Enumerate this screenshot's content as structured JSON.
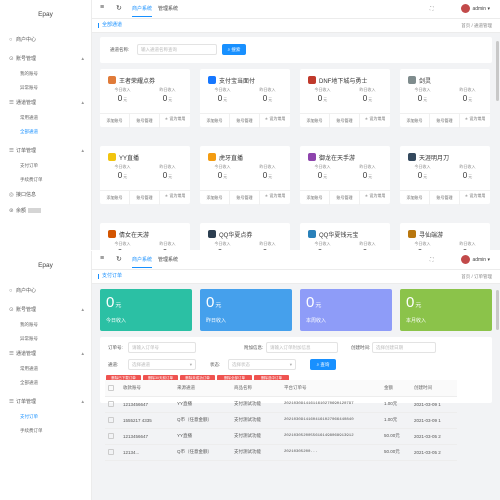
{
  "app_name": "Epay",
  "sidebar": {
    "items": [
      {
        "label": "商户中心"
      },
      {
        "label": "账号管理",
        "sub": [
          "我的账号",
          "异常账号"
        ]
      },
      {
        "label": "通道管理",
        "sub": [
          "常用通道",
          "全部通道"
        ]
      },
      {
        "label": "订单管理",
        "sub": [
          "支付订单",
          "手续费订单"
        ]
      },
      {
        "label": "接口信息"
      },
      {
        "label": "余额"
      }
    ]
  },
  "topbar": {
    "tabs": [
      "商户系统",
      "管理系统"
    ],
    "user": "admin",
    "avatar_color": "#c24a4a",
    "icons": [
      "menu-icon",
      "refresh-icon",
      "fullscreen-icon",
      "user-avatar"
    ]
  },
  "screen1": {
    "page_title": "全部通道",
    "breadcrumb": "首页 / 通道管理",
    "search_label": "通道名称:",
    "search_placeholder": "输入通道名称查询",
    "search_button": "搜索",
    "stat_labels": [
      "今日收入",
      "昨日收入"
    ],
    "stat_value": "0",
    "stat_unit": "元",
    "foot_labels": [
      "添加账号",
      "账号管理",
      "设为常用"
    ],
    "cards": [
      {
        "name": "王者荣耀点券",
        "icon_color": "#e07b39"
      },
      {
        "name": "支付宝当面付",
        "icon_color": "#1677ff"
      },
      {
        "name": "DNF地下城与勇士",
        "icon_color": "#c0392b"
      },
      {
        "name": "剑灵",
        "icon_color": "#7f8c8d"
      },
      {
        "name": "YY直播",
        "icon_color": "#f1c40f"
      },
      {
        "name": "虎牙直播",
        "icon_color": "#f39c12"
      },
      {
        "name": "御龙在天手游",
        "icon_color": "#8e44ad"
      },
      {
        "name": "天涯明月刀",
        "icon_color": "#34495e"
      },
      {
        "name": "倩女在天游",
        "icon_color": "#d35400"
      },
      {
        "name": "QQ华夏点券",
        "icon_color": "#2c3e50"
      },
      {
        "name": "QQ华夏钱元宝",
        "icon_color": "#2980b9"
      },
      {
        "name": "寻仙端游",
        "icon_color": "#b9770e"
      }
    ]
  },
  "screen2": {
    "page_title": "支付订单",
    "breadcrumb": "首页 / 订单管理",
    "stats": [
      {
        "value": "0",
        "unit": "元",
        "label": "今日收入",
        "color": "#2bc0a4"
      },
      {
        "value": "0",
        "unit": "元",
        "label": "昨日收入",
        "color": "#45a0ec"
      },
      {
        "value": "0",
        "unit": "元",
        "label": "本周收入",
        "color": "#8e9cf8"
      },
      {
        "value": "0",
        "unit": "元",
        "label": "本月收入",
        "color": "#8bc34a"
      }
    ],
    "filter": {
      "order_label": "订单号:",
      "order_placeholder": "请输入订单号",
      "attach_label": "附加信息:",
      "attach_placeholder": "请输入订单附加信息",
      "time_label": "创建时间:",
      "time_placeholder": "选择创建日期",
      "channel_label": "通道:",
      "channel_placeholder": "选择通道",
      "status_label": "状态:",
      "status_placeholder": "选择状态",
      "query_button": "查询"
    },
    "action_buttons": [
      "删除已下载订单",
      "删除30天前订单",
      "删除未成功订单",
      "删除全部订单",
      "删除选中订单"
    ],
    "table": {
      "headers": [
        "收款账号",
        "来源通道",
        "商品名称",
        "平台订单号",
        "金额",
        "创建时间"
      ],
      "rows": [
        [
          "1213456647",
          "YY直播",
          "支付测试功能",
          "20210309141611610270690120797",
          "1.00元",
          "2021-03-09 1"
        ],
        [
          "1555217 4335",
          "Q币（任意金额）",
          "支付测试功能",
          "20210309141604161027066440840",
          "1.00元",
          "2021-03-09 1"
        ],
        [
          "1213456647",
          "YY直播",
          "支付测试功能",
          "20210305200556161498068913912",
          "50.00元",
          "2021-03-05 2"
        ],
        [
          "12134...",
          "Q币（任意金额）",
          "支付测试功能",
          "20210305200...",
          "50.00元",
          "2021-03-05 2"
        ]
      ]
    }
  }
}
